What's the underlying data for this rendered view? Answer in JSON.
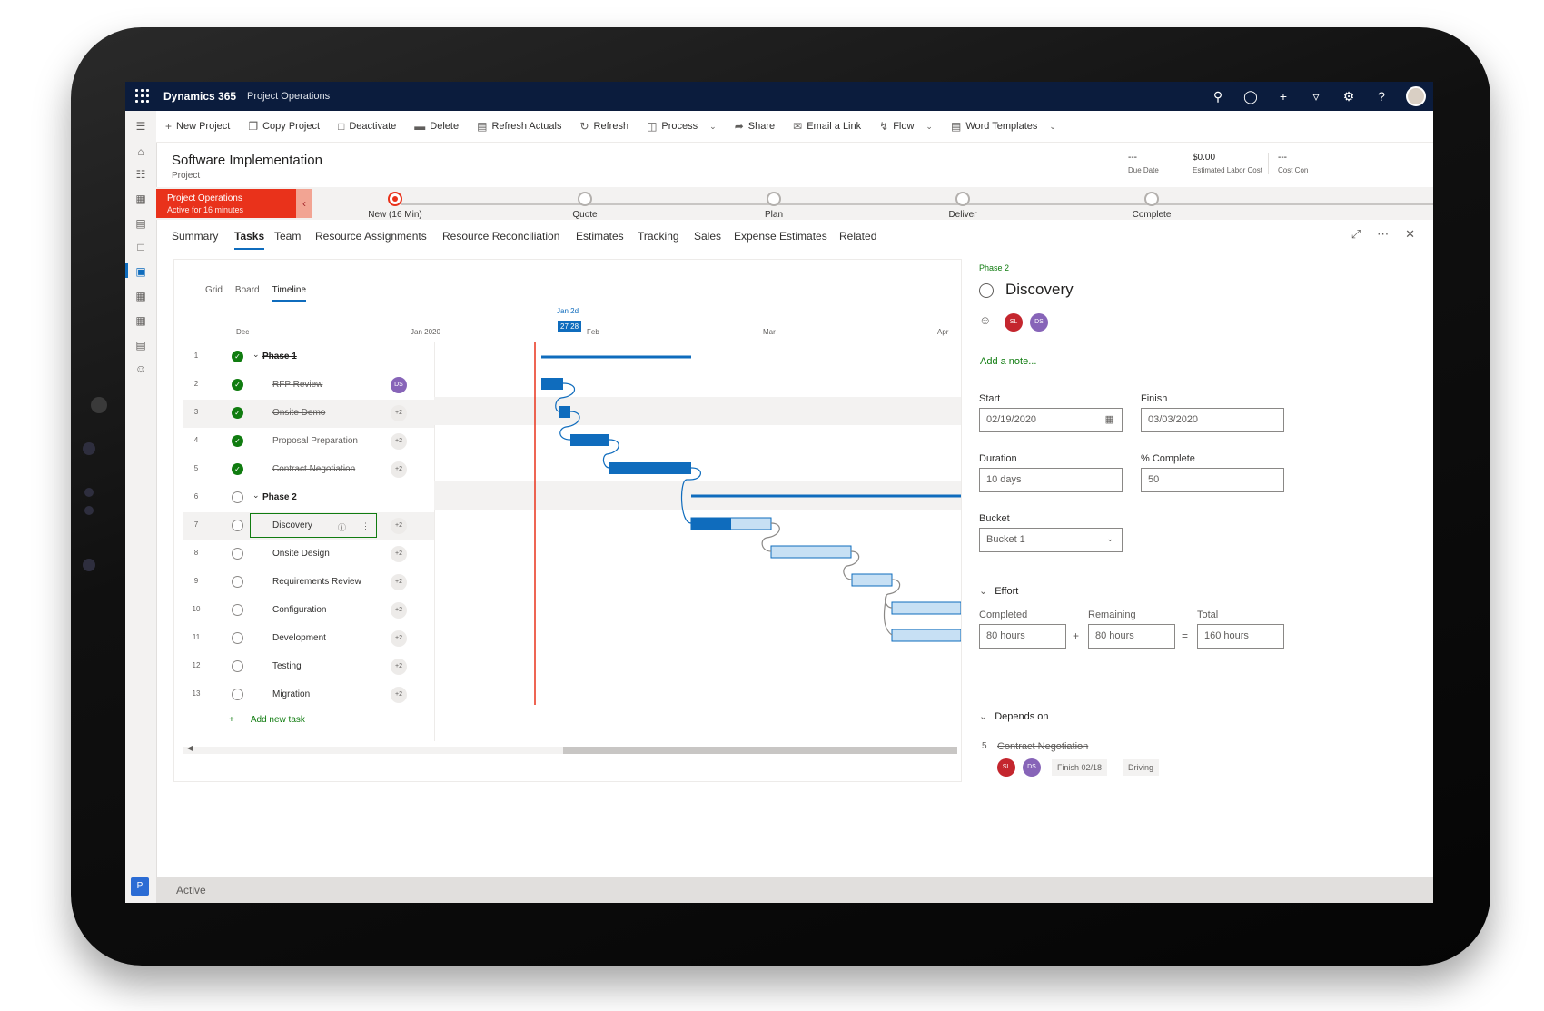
{
  "topbar": {
    "brand": "Dynamics 365",
    "app": "Project Operations",
    "icons": [
      "search-icon",
      "task-icon",
      "plus-icon",
      "filter-icon",
      "settings-icon",
      "help-icon",
      "user-avatar"
    ]
  },
  "commands": [
    {
      "label": "New Project",
      "icon": "plus-icon"
    },
    {
      "label": "Copy Project",
      "icon": "copy-icon"
    },
    {
      "label": "Deactivate",
      "icon": "deactivate-icon"
    },
    {
      "label": "Delete",
      "icon": "delete-icon"
    },
    {
      "label": "Refresh Actuals",
      "icon": "refresh-actuals-icon"
    },
    {
      "label": "Refresh",
      "icon": "refresh-icon"
    },
    {
      "label": "Process",
      "icon": "process-icon",
      "dropdown": true
    },
    {
      "label": "Share",
      "icon": "share-icon"
    },
    {
      "label": "Email a Link",
      "icon": "email-icon"
    },
    {
      "label": "Flow",
      "icon": "flow-icon",
      "dropdown": true
    },
    {
      "label": "Word Templates",
      "icon": "word-icon",
      "dropdown": true
    }
  ],
  "header": {
    "title": "Software Implementation",
    "entity": "Project",
    "fields": [
      {
        "value": "---",
        "label": "Due Date"
      },
      {
        "value": "$0.00",
        "label": "Estimated Labor Cost"
      },
      {
        "value": "---",
        "label": "Cost Con"
      }
    ]
  },
  "bpf": {
    "name": "Project Operations",
    "active_for": "Active for 16 minutes",
    "stages": [
      {
        "label": "New  (16 Min)",
        "active": true
      },
      {
        "label": "Quote",
        "active": false
      },
      {
        "label": "Plan",
        "active": false
      },
      {
        "label": "Deliver",
        "active": false
      },
      {
        "label": "Complete",
        "active": false
      }
    ]
  },
  "tabs": [
    "Summary",
    "Tasks",
    "Team",
    "Resource Assignments",
    "Resource Reconciliation",
    "Estimates",
    "Tracking",
    "Sales",
    "Expense Estimates",
    "Related"
  ],
  "selected_tab": "Tasks",
  "schedule": {
    "views": [
      "Grid",
      "Board",
      "Timeline"
    ],
    "selected_view": "Timeline",
    "timeline": {
      "months": [
        "Dec",
        "Jan 2020",
        "Feb",
        "Mar",
        "Apr"
      ],
      "today_label": "Jan 2d",
      "today_dates": "27 28"
    },
    "tasks": [
      {
        "n": "1",
        "name": "Phase 1",
        "done": true,
        "phase": true,
        "assignee": ""
      },
      {
        "n": "2",
        "name": "RFP Review",
        "done": true,
        "phase": false,
        "assignee": "DS"
      },
      {
        "n": "3",
        "name": "Onsite Demo",
        "done": true,
        "phase": false,
        "assignee": "+2"
      },
      {
        "n": "4",
        "name": "Proposal Preparation",
        "done": true,
        "phase": false,
        "assignee": "+2"
      },
      {
        "n": "5",
        "name": "Contract Negotiation",
        "done": true,
        "phase": false,
        "assignee": "+2"
      },
      {
        "n": "6",
        "name": "Phase 2",
        "done": false,
        "phase": true,
        "assignee": ""
      },
      {
        "n": "7",
        "name": "Discovery",
        "done": false,
        "phase": false,
        "assignee": "+2",
        "selected": true
      },
      {
        "n": "8",
        "name": "Onsite Design",
        "done": false,
        "phase": false,
        "assignee": "+2"
      },
      {
        "n": "9",
        "name": "Requirements Review",
        "done": false,
        "phase": false,
        "assignee": "+2"
      },
      {
        "n": "10",
        "name": "Configuration",
        "done": false,
        "phase": false,
        "assignee": "+2"
      },
      {
        "n": "11",
        "name": "Development",
        "done": false,
        "phase": false,
        "assignee": "+2"
      },
      {
        "n": "12",
        "name": "Testing",
        "done": false,
        "phase": false,
        "assignee": "+2"
      },
      {
        "n": "13",
        "name": "Migration",
        "done": false,
        "phase": false,
        "assignee": "+2"
      }
    ],
    "add_task": "Add new task",
    "colors": {
      "bar": "#0f6cbd",
      "bar_light": "#c7e0f4",
      "today": "#e9321b",
      "done": "#107c10"
    }
  },
  "detail": {
    "phase": "Phase 2",
    "title": "Discovery",
    "assignees": [
      "SL",
      "DS"
    ],
    "add_note": "Add a note...",
    "start_label": "Start",
    "start": "02/19/2020",
    "finish_label": "Finish",
    "finish": "03/03/2020",
    "duration_label": "Duration",
    "duration": "10 days",
    "percent_label": "% Complete",
    "percent": "50",
    "bucket_label": "Bucket",
    "bucket": "Bucket 1",
    "effort_label": "Effort",
    "completed_label": "Completed",
    "completed": "80 hours",
    "remaining_label": "Remaining",
    "remaining": "80 hours",
    "total_label": "Total",
    "total": "160 hours",
    "depends_label": "Depends on",
    "dependency": {
      "n": "5",
      "name": "Contract Negotiation",
      "assignees": [
        "SL",
        "DS"
      ],
      "finish": "Finish 02/18",
      "type": "Driving"
    }
  },
  "status": "Active"
}
